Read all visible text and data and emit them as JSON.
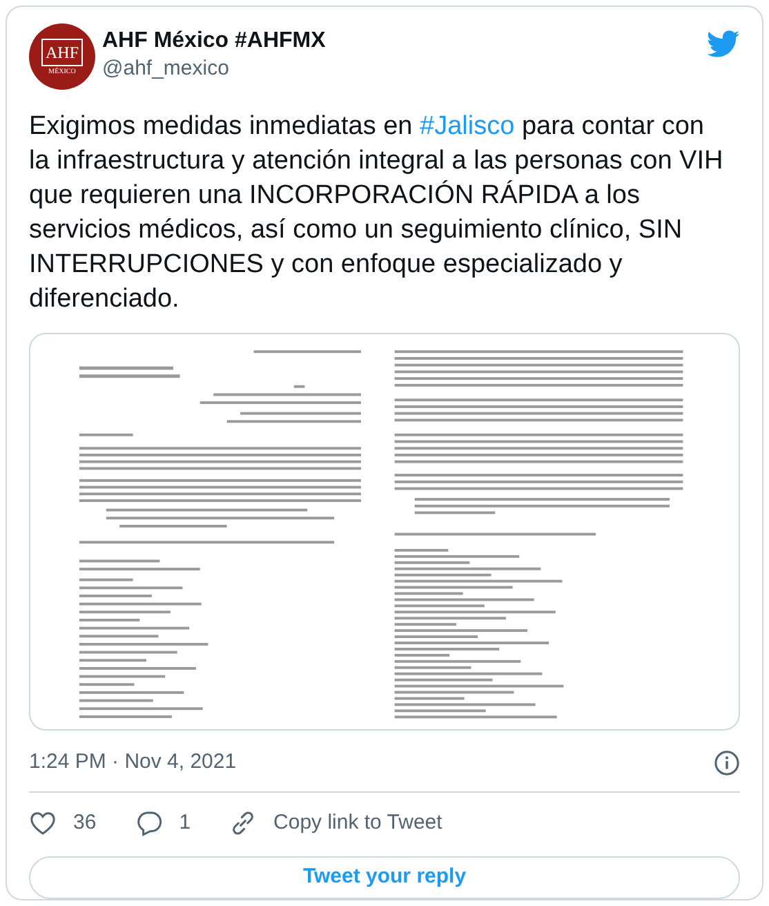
{
  "author": {
    "avatar_text": "AHF",
    "avatar_subtext": "MÉXICO",
    "name": "AHF México #AHFMX",
    "handle": "@ahf_mexico"
  },
  "tweet": {
    "segments": [
      {
        "kind": "text",
        "text": "Exigimos medidas inmediatas en "
      },
      {
        "kind": "hashtag",
        "text": "#Jalisco"
      },
      {
        "kind": "text",
        "text": " para contar con la infraestructura y atención integral a las personas con VIH que requieren una INCORPORACIÓN RÁPIDA a los servicios médicos, así como un seguimiento clínico, SIN INTERRUPCIONES y con enfoque especializado y diferenciado."
      }
    ]
  },
  "timestamp": "1:24 PM · Nov 4, 2021",
  "actions": [
    {
      "kind": "like",
      "label": "36"
    },
    {
      "kind": "reply",
      "label": "1"
    },
    {
      "kind": "link",
      "label": "Copy link to Tweet"
    }
  ],
  "reply_button": "Tweet your reply"
}
